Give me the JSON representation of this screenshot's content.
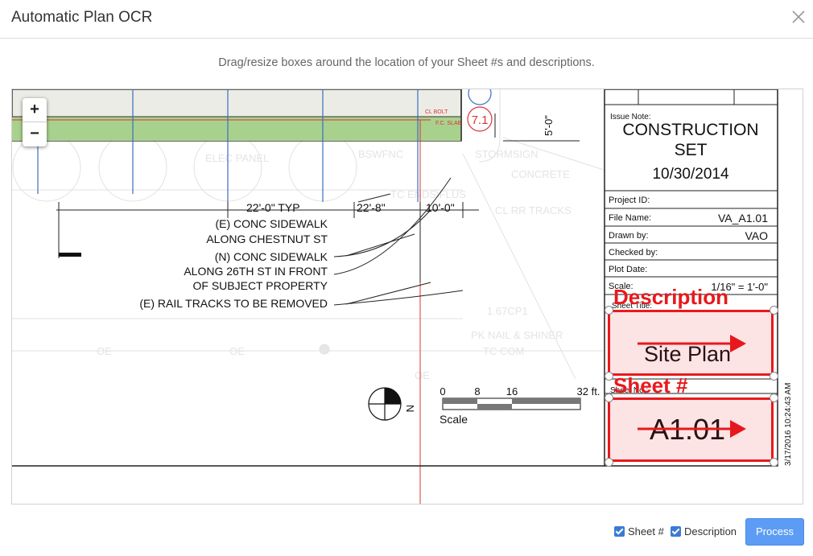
{
  "header": {
    "title": "Automatic Plan OCR"
  },
  "instructions": "Drag/resize boxes around the location of your Sheet #s and descriptions.",
  "zoom": {
    "in_label": "+",
    "out_label": "−"
  },
  "plan": {
    "dimensions": [
      "22'-0\" TYP",
      "22'-8\"",
      "10'-0\"",
      "5'-0\""
    ],
    "notes": [
      "(E) CONC SIDEWALK",
      "ALONG CHESTNUT ST",
      "(N) CONC SIDEWALK",
      "ALONG 26TH ST IN FRONT",
      "OF SUBJECT PROPERTY",
      "(E)   RAIL TRACKS TO BE REMOVED"
    ],
    "callouts": {
      "cl_bolt": "CL BOLT",
      "fc_slab": "F.C. SLAB",
      "grid_tag": "7.1"
    },
    "scale_bar": {
      "ticks": [
        "0",
        "8",
        "16",
        "32 ft."
      ],
      "label": "Scale"
    },
    "north_label": "N",
    "timestamp": "3/17/2016 10:24:43 AM"
  },
  "title_block": {
    "issue_note_label": "Issue Note:",
    "issue_line1": "CONSTRUCTION",
    "issue_line2": "SET",
    "issue_date": "10/30/2014",
    "project_id_label": "Project ID:",
    "file_name_label": "File Name:",
    "file_name_value": "VA_A1.01",
    "drawn_by_label": "Drawn by:",
    "drawn_by_value": "VAO",
    "checked_by_label": "Checked by:",
    "plot_date_label": "Plot Date:",
    "scale_label": "Scale:",
    "scale_value": "1/16\" = 1'-0\"",
    "sheet_title_label": "Sheet Title:",
    "sheet_title_value": "Site Plan",
    "sheet_no_label": "Sheet No.:",
    "sheet_no_value": "A1.01"
  },
  "annotations": {
    "description_label": "Description",
    "sheet_label": "Sheet #"
  },
  "footer": {
    "sheet_checkbox": "Sheet #",
    "description_checkbox": "Description",
    "process_button": "Process"
  },
  "colors": {
    "accent": "#5c9cf5",
    "annotation": "#e8191d",
    "green_strip": "#a9d18e"
  }
}
